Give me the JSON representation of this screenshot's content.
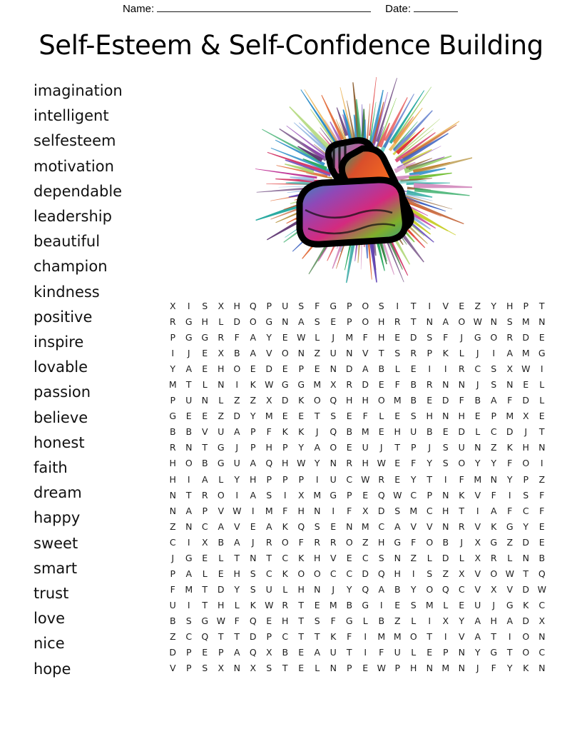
{
  "header": {
    "name_label": "Name:",
    "date_label": "Date:"
  },
  "title": "Self-Esteem & Self-Confidence Building",
  "illustration": {
    "name": "flexed-biceps-burst",
    "description": "Flexed bicep arm with multicolored radial burst",
    "outline_color": "#000000"
  },
  "words": [
    "imagination",
    "intelligent",
    "selfesteem",
    "motivation",
    "dependable",
    "leadership",
    "beautiful",
    "champion",
    "kindness",
    "positive",
    "inspire",
    "lovable",
    "passion",
    "believe",
    "honest",
    "faith",
    "dream",
    "happy",
    "sweet",
    "smart",
    "trust",
    "love",
    "nice",
    "hope"
  ],
  "grid": {
    "columns": 24,
    "rows_count": 25,
    "rows": [
      "XISXHQPUSFGPOSITIVEZYHPT",
      "RGHLDOGNASEPOHRTNAOWNSMN",
      "PGGRFAYEWLJMFHEDSFJGORDE",
      "IJEXBAVONZUNVTSRPKLJIAMG",
      "YAEHOEDEPENDABLEIIRCSXWI",
      "MTLNIKWGGMXRDEFBRNNJSNEL",
      "PUNLZZXDKOQHHOMBEDFBAFDL",
      "GEEZDYMEETSEFLESHNHEPMXE",
      "BBVUAPFKKJQBMEHUBEDLCDJT",
      "RNTGJPHPYAOEUJTPJSUNZKHN",
      "HOBGUAQHWYNRHWEFYSOYYFOI",
      "HIALYHPPPIUCWREYTIFMNYPZ",
      "NTROIASIXMGPEQWCPNKVFISF",
      "NAPVWIMFHNIFXDSMCHTIAFCF",
      "ZNCAVEAKQSENMCAVVNRVKGYE",
      "CIXBAJROFRROZHGFOBJXGZDE",
      "JGELTNTCKHVECSNZLDLXRLNB",
      "PALEHSCKOOCCDQHISZXVOWTQ",
      "FMTDYSULHNJYQABYOQCVXVDW",
      "UITHLKWRTEMBGIESMLEUJGKC",
      "BSGWFQEHTSFGLBZLIXYAHADX",
      "ZCQTTDPCTTKFIMMOTIVATION",
      "DPEPAQXBEAUTIFULEPNYGTOC",
      "VPSXNXSTELNPEWPHNMNJFYKN"
    ]
  }
}
